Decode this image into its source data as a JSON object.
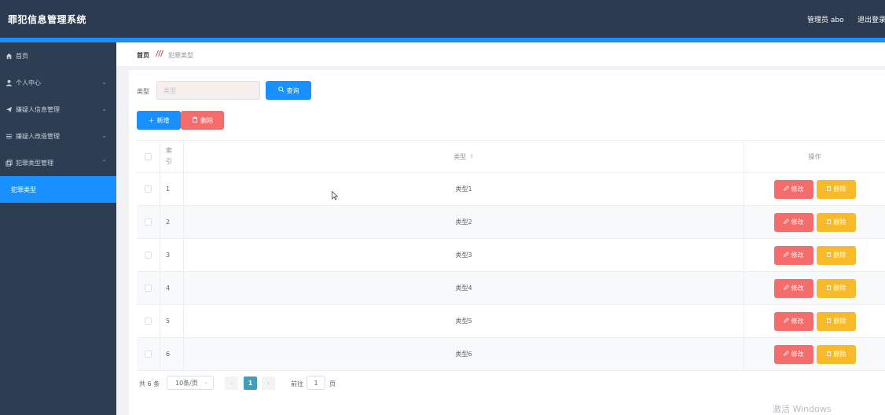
{
  "header": {
    "title": "罪犯信息管理系统",
    "user_label": "管理员 abo",
    "logout_label": "退出登录"
  },
  "sidebar": {
    "items": [
      {
        "label": "首页",
        "icon": "home-icon"
      },
      {
        "label": "个人中心",
        "icon": "user-icon"
      },
      {
        "label": "嫌疑人信息管理",
        "icon": "send-icon"
      },
      {
        "label": "嫌疑人改造管理",
        "icon": "list-icon"
      },
      {
        "label": "犯罪类型管理",
        "icon": "copy-icon"
      },
      {
        "label": "犯罪类型",
        "icon": ""
      }
    ]
  },
  "breadcrumb": {
    "home": "首页",
    "current": "犯罪类型"
  },
  "search": {
    "label": "类型",
    "placeholder": "类型",
    "query_label": "查询"
  },
  "actions": {
    "add_label": "新增",
    "delete_label": "删除"
  },
  "table": {
    "columns": {
      "index_line1": "索",
      "index_line2": "引",
      "type": "类型",
      "ops": "操作"
    },
    "edit_label": "修改",
    "delete_label": "删除",
    "rows": [
      {
        "index": "1",
        "type": "类型1"
      },
      {
        "index": "2",
        "type": "类型2"
      },
      {
        "index": "3",
        "type": "类型3"
      },
      {
        "index": "4",
        "type": "类型4"
      },
      {
        "index": "5",
        "type": "类型5"
      },
      {
        "index": "6",
        "type": "类型6"
      }
    ]
  },
  "pagination": {
    "total": "共 6 条",
    "page_size": "10条/页",
    "current_page": "1",
    "goto_label": "前往",
    "goto_value": "1",
    "goto_unit": "页"
  },
  "watermark": "激活 Windows",
  "colors": {
    "primary": "#1890ff",
    "danger": "#f56c6c",
    "warning": "#f7ba2a",
    "header_bg": "#2b3a4e",
    "sidebar_bg": "#2e3e52"
  }
}
